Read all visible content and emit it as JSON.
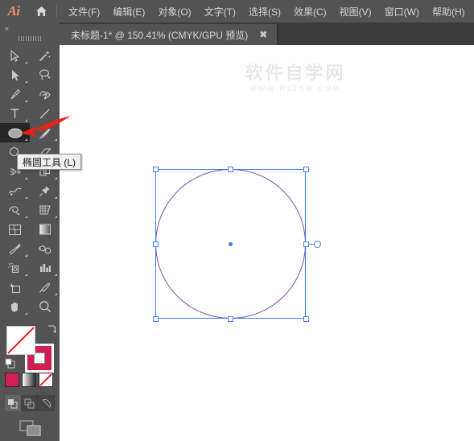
{
  "app": {
    "logo_text": "Ai",
    "home_icon": "home-icon"
  },
  "menu": {
    "items": [
      {
        "label": "文件(F)",
        "name": "menu-file"
      },
      {
        "label": "编辑(E)",
        "name": "menu-edit"
      },
      {
        "label": "对象(O)",
        "name": "menu-object"
      },
      {
        "label": "文字(T)",
        "name": "menu-type"
      },
      {
        "label": "选择(S)",
        "name": "menu-select"
      },
      {
        "label": "效果(C)",
        "name": "menu-effect"
      },
      {
        "label": "视图(V)",
        "name": "menu-view"
      },
      {
        "label": "窗口(W)",
        "name": "menu-window"
      },
      {
        "label": "帮助(H)",
        "name": "menu-help"
      }
    ]
  },
  "tab": {
    "title": "未标题-1* @ 150.41% (CMYK/GPU 预览)",
    "close_label": "✖",
    "document_name": "未标题-1",
    "modified": "*",
    "zoom_level": "150.41%",
    "color_mode": "CMYK/GPU 预览"
  },
  "toolpanel": {
    "collapse_label": "«",
    "grip_icon": "drag-grip-icon",
    "tools": [
      [
        {
          "name": "selection-tool",
          "icon": "arrow-cursor-icon",
          "selected": false,
          "has_flyout": true
        },
        {
          "name": "magic-wand-tool",
          "icon": "magic-wand-icon",
          "selected": false,
          "has_flyout": false
        }
      ],
      [
        {
          "name": "direct-selection-tool",
          "icon": "direct-select-arrow-icon",
          "selected": false,
          "has_flyout": true
        },
        {
          "name": "lasso-tool",
          "icon": "lasso-icon",
          "selected": false,
          "has_flyout": false
        }
      ],
      [
        {
          "name": "pen-tool",
          "icon": "pen-nib-icon",
          "selected": false,
          "has_flyout": true
        },
        {
          "name": "curvature-tool",
          "icon": "curvature-pen-icon",
          "selected": false,
          "has_flyout": false
        }
      ],
      [
        {
          "name": "type-tool",
          "icon": "type-t-icon",
          "selected": false,
          "has_flyout": true
        },
        {
          "name": "line-segment-tool",
          "icon": "line-diagonal-icon",
          "selected": false,
          "has_flyout": true
        }
      ],
      [
        {
          "name": "ellipse-tool",
          "icon": "ellipse-icon",
          "selected": true,
          "has_flyout": true
        },
        {
          "name": "paintbrush-tool",
          "icon": "paintbrush-icon",
          "selected": false,
          "has_flyout": true
        }
      ],
      [
        {
          "name": "shaper-tool",
          "icon": "shaper-icon",
          "selected": false,
          "has_flyout": true
        },
        {
          "name": "eraser-tool",
          "icon": "eraser-icon",
          "selected": false,
          "has_flyout": true
        }
      ],
      [
        {
          "name": "rotate-tool",
          "icon": "rotate-icon",
          "selected": false,
          "has_flyout": true
        },
        {
          "name": "shape-builder-tool",
          "icon": "shape-builder-icon",
          "selected": false,
          "has_flyout": true
        }
      ],
      [
        {
          "name": "width-tool",
          "icon": "width-warp-icon",
          "selected": false,
          "has_flyout": true
        },
        {
          "name": "free-transform-tool",
          "icon": "pushpin-icon",
          "selected": false,
          "has_flyout": true
        }
      ],
      [
        {
          "name": "puppet-warp-tool",
          "icon": "mesh-web-icon",
          "selected": false,
          "has_flyout": true
        },
        {
          "name": "perspective-grid-tool",
          "icon": "perspective-grid-icon",
          "selected": false,
          "has_flyout": true
        }
      ],
      [
        {
          "name": "mesh-tool",
          "icon": "gradient-mesh-icon",
          "selected": false,
          "has_flyout": false
        },
        {
          "name": "gradient-tool",
          "icon": "gradient-square-icon",
          "selected": false,
          "has_flyout": false
        }
      ],
      [
        {
          "name": "eyedropper-tool",
          "icon": "eyedropper-icon",
          "selected": false,
          "has_flyout": true
        },
        {
          "name": "blend-tool",
          "icon": "blend-icon",
          "selected": false,
          "has_flyout": false
        }
      ],
      [
        {
          "name": "symbol-sprayer-tool",
          "icon": "symbol-sprayer-icon",
          "selected": false,
          "has_flyout": true
        },
        {
          "name": "column-graph-tool",
          "icon": "bar-chart-icon",
          "selected": false,
          "has_flyout": true
        }
      ],
      [
        {
          "name": "artboard-tool",
          "icon": "artboard-icon",
          "selected": false,
          "has_flyout": false
        },
        {
          "name": "slice-tool",
          "icon": "knife-icon",
          "selected": false,
          "has_flyout": true
        }
      ],
      [
        {
          "name": "hand-tool",
          "icon": "hand-icon",
          "selected": false,
          "has_flyout": true
        },
        {
          "name": "zoom-tool",
          "icon": "magnifier-icon",
          "selected": false,
          "has_flyout": false
        }
      ]
    ],
    "color_controls": {
      "fill": {
        "name": "fill-swatch",
        "value": "none",
        "color": "#ffffff"
      },
      "stroke": {
        "name": "stroke-swatch",
        "color": "#cf1f53"
      },
      "swap_icon": "swap-fill-stroke-icon",
      "default_icon": "default-fill-stroke-icon",
      "mini_swatches": [
        {
          "name": "color-swatch-button",
          "icon": "solid-color-icon",
          "color": "#cf1f53"
        },
        {
          "name": "gradient-swatch-button",
          "icon": "gradient-icon"
        },
        {
          "name": "none-swatch-button",
          "icon": "none-slash-icon"
        }
      ],
      "draw_modes": [
        {
          "name": "draw-normal-button",
          "icon": "draw-normal-icon",
          "active": true
        },
        {
          "name": "draw-behind-button",
          "icon": "draw-behind-icon",
          "active": false
        },
        {
          "name": "draw-inside-button",
          "icon": "draw-inside-icon",
          "active": false
        }
      ],
      "screen_mode": {
        "name": "screen-mode-button",
        "icon": "screen-mode-icon"
      }
    }
  },
  "tooltip": {
    "text": "椭圆工具 (L)",
    "tool_name": "椭圆工具",
    "shortcut": "(L)"
  },
  "canvas": {
    "watermark": {
      "chinese": "软件自学网",
      "url": "WWW.RJZXW.COM"
    },
    "artwork": {
      "shape": "ellipse",
      "stroke_color": "#7b4fa8",
      "selection_color": "#3d7ef0",
      "selected": true,
      "handles": 8
    }
  },
  "colors": {
    "chrome_bg": "#535353",
    "tabbar_bg": "#3c3c3c",
    "canvas_bg": "#ffffff",
    "accent_orange": "#f2906a",
    "stroke_crimson": "#cf1f53",
    "selection_blue": "#3d7ef0",
    "annotation_red": "#ef2116"
  }
}
